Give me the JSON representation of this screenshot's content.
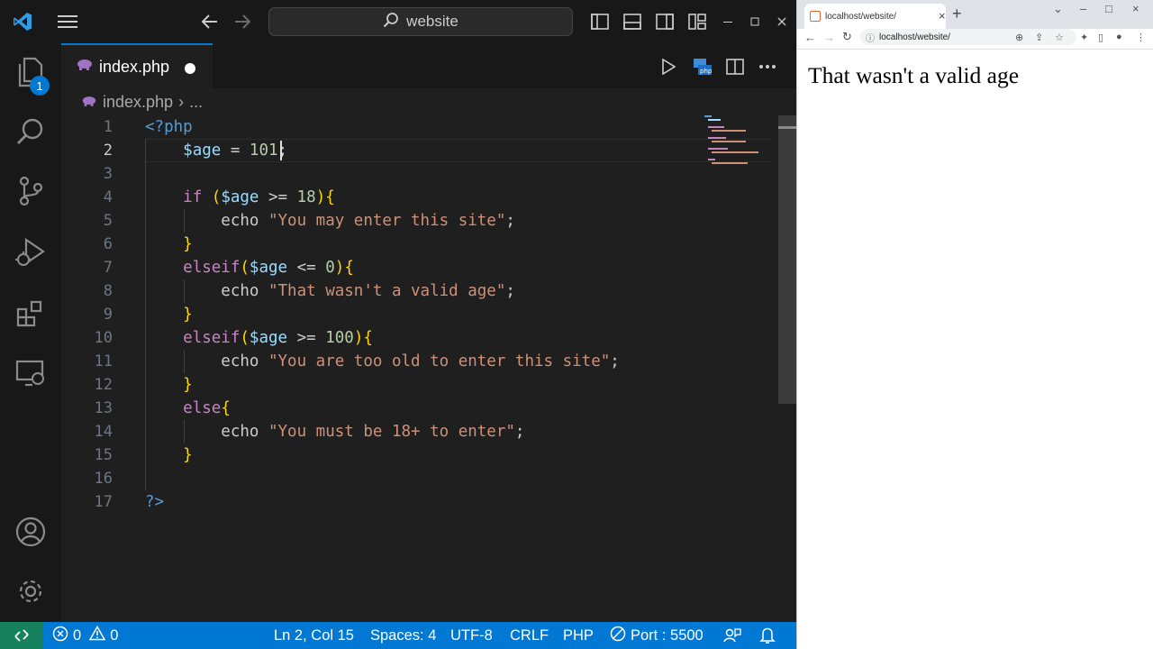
{
  "editor": {
    "search": {
      "text": "website"
    },
    "tab": {
      "filename": "index.php"
    },
    "breadcrumb": {
      "file": "index.php",
      "chevron": "›",
      "more": "..."
    },
    "line_numbers": [
      "1",
      "2",
      "3",
      "4",
      "5",
      "6",
      "7",
      "8",
      "9",
      "10",
      "11",
      "12",
      "13",
      "14",
      "15",
      "16",
      "17"
    ],
    "current_line": 2,
    "code": {
      "l1_open": "<?php",
      "l2_var": "$age",
      "l2_eq": " = ",
      "l2_num": "101",
      "l2_semi": ";",
      "l4_kw": "if",
      "l4_open": " (",
      "l4_var": "$age",
      "l4_op": " >= ",
      "l4_num": "18",
      "l4_close": ")",
      "l4_brace": "{",
      "l5_fn": "echo ",
      "l5_str": "\"You may enter this site\"",
      "l5_semi": ";",
      "l6_brace": "}",
      "l7_kw": "elseif",
      "l7_open": "(",
      "l7_var": "$age",
      "l7_op": " <= ",
      "l7_num": "0",
      "l7_close": ")",
      "l7_brace": "{",
      "l8_fn": "echo ",
      "l8_str": "\"That wasn't a valid age\"",
      "l8_semi": ";",
      "l9_brace": "}",
      "l10_kw": "elseif",
      "l10_open": "(",
      "l10_var": "$age",
      "l10_op": " >= ",
      "l10_num": "100",
      "l10_close": ")",
      "l10_brace": "{",
      "l11_fn": "echo ",
      "l11_str": "\"You are too old to enter this site\"",
      "l11_semi": ";",
      "l12_brace": "}",
      "l13_kw": "else",
      "l13_brace": "{",
      "l14_fn": "echo ",
      "l14_str": "\"You must be 18+ to enter\"",
      "l14_semi": ";",
      "l15_brace": "}",
      "l17_close": "?>"
    },
    "source_control_badge": "1"
  },
  "statusbar": {
    "errors": "0",
    "warnings": "0",
    "cursor": "Ln 2, Col 15",
    "spaces": "Spaces: 4",
    "encoding": "UTF-8",
    "eol": "CRLF",
    "language": "PHP",
    "port": "Port : 5500"
  },
  "browser": {
    "tab_title": "localhost/website/",
    "url": "localhost/website/",
    "output": "That wasn't a valid age"
  },
  "colors": {
    "accent": "#0078d4",
    "remote": "#16825d",
    "string": "#ce9178",
    "variable": "#9cdcfe",
    "keyword": "#c586c0",
    "number": "#b5cea8"
  }
}
